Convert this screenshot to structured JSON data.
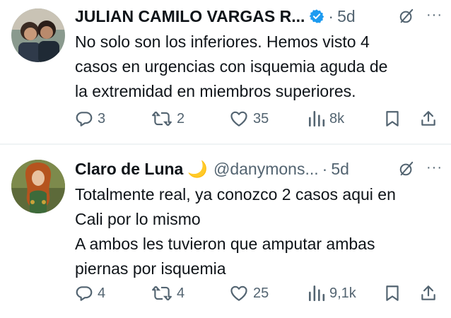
{
  "tweets": [
    {
      "author_name": "JULIAN CAMILO VARGAS R...",
      "handle": "",
      "separator": "·",
      "time": "5d",
      "more": "···",
      "text_lines": [
        "No solo son los inferiores. Hemos visto 4",
        "casos en urgencias con isquemia aguda de",
        "la extremidad en miembros superiores."
      ],
      "replies": "3",
      "retweets": "2",
      "likes": "35",
      "views": "8k",
      "verified": true
    },
    {
      "author_name": "Claro de Luna",
      "name_emoji": "🌙",
      "handle": "@danymons...",
      "separator": "·",
      "time": "5d",
      "more": "···",
      "text_lines": [
        "Totalmente real, ya conozco 2 casos aqui en",
        "Cali por lo mismo",
        "A ambos les tuvieron que amputar ambas",
        "piernas por isquemia"
      ],
      "replies": "4",
      "retweets": "4",
      "likes": "25",
      "views": "9,1k",
      "verified": false
    }
  ],
  "colors": {
    "text": "#0f1419",
    "secondary": "#536471",
    "verified_blue": "#1d9bf0",
    "divider": "#eff3f4"
  },
  "icons": [
    "reply-icon",
    "retweet-icon",
    "like-icon",
    "views-icon",
    "bookmark-icon",
    "share-icon",
    "grok-icon",
    "verified-badge-icon",
    "more-icon"
  ]
}
